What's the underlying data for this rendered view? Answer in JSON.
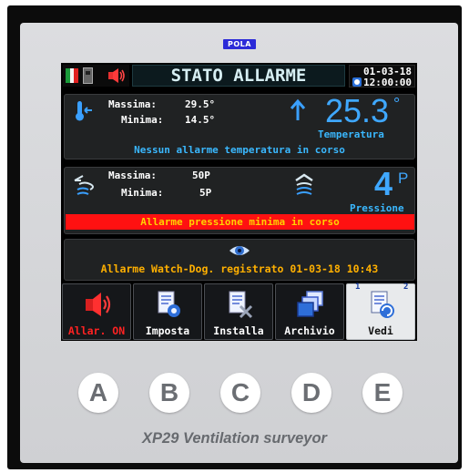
{
  "device": {
    "brand": "POLA",
    "model": "XP29 Ventilation surveyor"
  },
  "header": {
    "title": "STATO ALLARME",
    "date": "01-03-18",
    "time": "12:00:00",
    "icons": [
      "italy-flag-icon",
      "sim-card-icon",
      "alarm-speaker-icon",
      "clock-icon"
    ]
  },
  "temperature": {
    "max_label": "Massima:",
    "max_value": "29.5°",
    "min_label": "Minima:",
    "min_value": "14.5°",
    "current_value": "25.3",
    "unit": "°",
    "caption": "Temperatura",
    "status": "Nessun allarme temperatura in corso",
    "trend": "up"
  },
  "pressure": {
    "max_label": "Massima:",
    "max_value": "50P",
    "min_label": "Minima:",
    "min_value": "5P",
    "current_value": "4",
    "unit": "P",
    "caption": "Pressione",
    "alarm": "Allarme pressione minima in corso"
  },
  "watchdog": {
    "message": "Allarme Watch-Dog. registrato 01-03-18  10:43"
  },
  "function_keys": [
    {
      "label": "Allar. ON",
      "icon": "alarm-speaker-icon",
      "selected": false,
      "color": "#ff2222"
    },
    {
      "label": "Imposta",
      "icon": "settings-document-icon",
      "selected": false,
      "color": "#ffffff"
    },
    {
      "label": "Installa",
      "icon": "install-document-icon",
      "selected": false,
      "color": "#ffffff"
    },
    {
      "label": "Archivio",
      "icon": "archive-windows-icon",
      "selected": false,
      "color": "#ffffff"
    },
    {
      "label": "Vedi",
      "icon": "view-refresh-icon",
      "selected": true,
      "color": "#101010"
    }
  ],
  "page_indicator": [
    "1",
    "2"
  ],
  "hardware_buttons": [
    "A",
    "B",
    "C",
    "D",
    "E"
  ],
  "colors": {
    "accent_blue": "#3fa8ff",
    "alarm_red": "#ff1111",
    "alarm_text": "#ffd200",
    "watchdog_text": "#ffb000"
  }
}
